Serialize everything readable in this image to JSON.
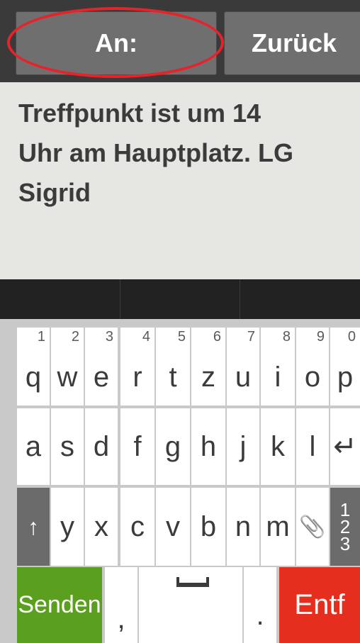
{
  "header": {
    "to_label": "An:",
    "back_label": "Zurück"
  },
  "message": {
    "text_line1": "Treffpunkt ist um 14",
    "text_line2": "Uhr am Hauptplatz. LG",
    "text_line3": "Sigrid"
  },
  "keyboard": {
    "row1": [
      {
        "main": "q",
        "sub": "1"
      },
      {
        "main": "w",
        "sub": "2"
      },
      {
        "main": "e",
        "sub": "3"
      },
      {
        "main": "r",
        "sub": "4"
      },
      {
        "main": "t",
        "sub": "5"
      },
      {
        "main": "z",
        "sub": "6"
      },
      {
        "main": "u",
        "sub": "7"
      },
      {
        "main": "i",
        "sub": "8"
      },
      {
        "main": "o",
        "sub": "9"
      },
      {
        "main": "p",
        "sub": "0"
      }
    ],
    "row2": [
      "a",
      "s",
      "d",
      "f",
      "g",
      "h",
      "j",
      "k",
      "l",
      "↵"
    ],
    "row3": [
      "↑",
      "y",
      "x",
      "c",
      "v",
      "b",
      "n",
      "m",
      "📎"
    ],
    "num_toggle": [
      "1",
      "2",
      "3"
    ],
    "send_label": "Senden",
    "comma_label": ",",
    "period_label": ".",
    "delete_label": "Entf"
  },
  "colors": {
    "send": "#5aa01e",
    "delete": "#e62e1e",
    "highlight": "#e8222a"
  }
}
